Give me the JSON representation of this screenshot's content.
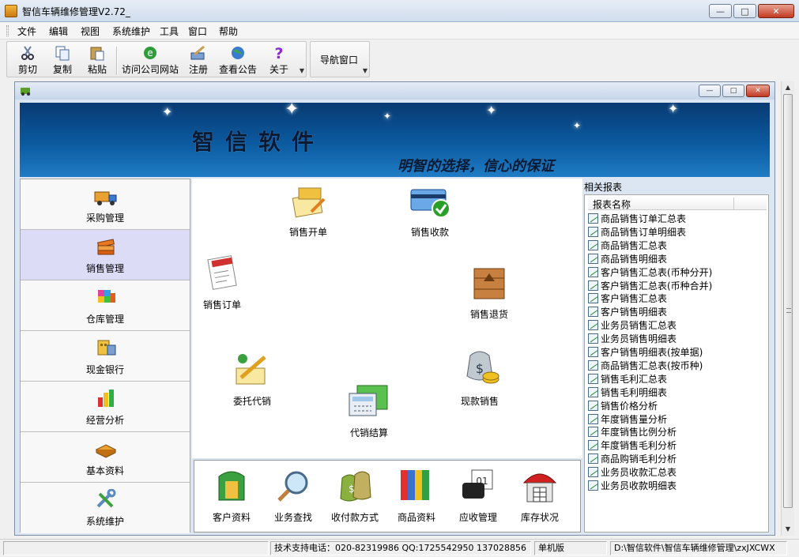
{
  "window": {
    "title": "智信车辆维修管理V2.72_"
  },
  "menu": [
    "文件",
    "编辑",
    "视图",
    "系统维护",
    "工具",
    "窗口",
    "帮助"
  ],
  "toolbar": {
    "cut": "剪切",
    "copy": "复制",
    "paste": "粘贴",
    "visit_site": "访问公司网站",
    "register": "注册",
    "notice": "查看公告",
    "about": "关于",
    "nav_window": "导航窗口"
  },
  "banner": {
    "brand": "智信软件",
    "slogan": "明智的选择，信心的保证"
  },
  "nav": [
    "采购管理",
    "销售管理",
    "仓库管理",
    "现金银行",
    "经营分析",
    "基本资料",
    "系统维护"
  ],
  "nav_active": "销售管理",
  "workspace": {
    "sales_order_open": "销售开单",
    "sales_receipt": "销售收款",
    "sales_order": "销售订单",
    "sales_return": "销售退货",
    "consign_sale": "委托代销",
    "cash_sale": "现款销售",
    "consign_settle": "代销结算"
  },
  "bottom": [
    "客户资料",
    "业务查找",
    "收付款方式",
    "商品资料",
    "应收管理",
    "库存状况"
  ],
  "reports": {
    "title": "相关报表",
    "column": "报表名称",
    "items": [
      "商品销售订单汇总表",
      "商品销售订单明细表",
      "商品销售汇总表",
      "商品销售明细表",
      "客户销售汇总表(币种分开)",
      "客户销售汇总表(币种合并)",
      "客户销售汇总表",
      "客户销售明细表",
      "业务员销售汇总表",
      "业务员销售明细表",
      "客户销售明细表(按单据)",
      "商品销售汇总表(按币种)",
      "销售毛利汇总表",
      "销售毛利明细表",
      "销售价格分析",
      "年度销售量分析",
      "年度销售比例分析",
      "年度销售毛利分析",
      "商品购销毛利分析",
      "业务员收款汇总表",
      "业务员收款明细表"
    ]
  },
  "status": {
    "support": "技术支持电话：020-82319986 QQ:1725542950 137028856",
    "mode": "单机版",
    "path": "D:\\智信软件\\智信车辆维修管理\\zxJXCWX"
  }
}
